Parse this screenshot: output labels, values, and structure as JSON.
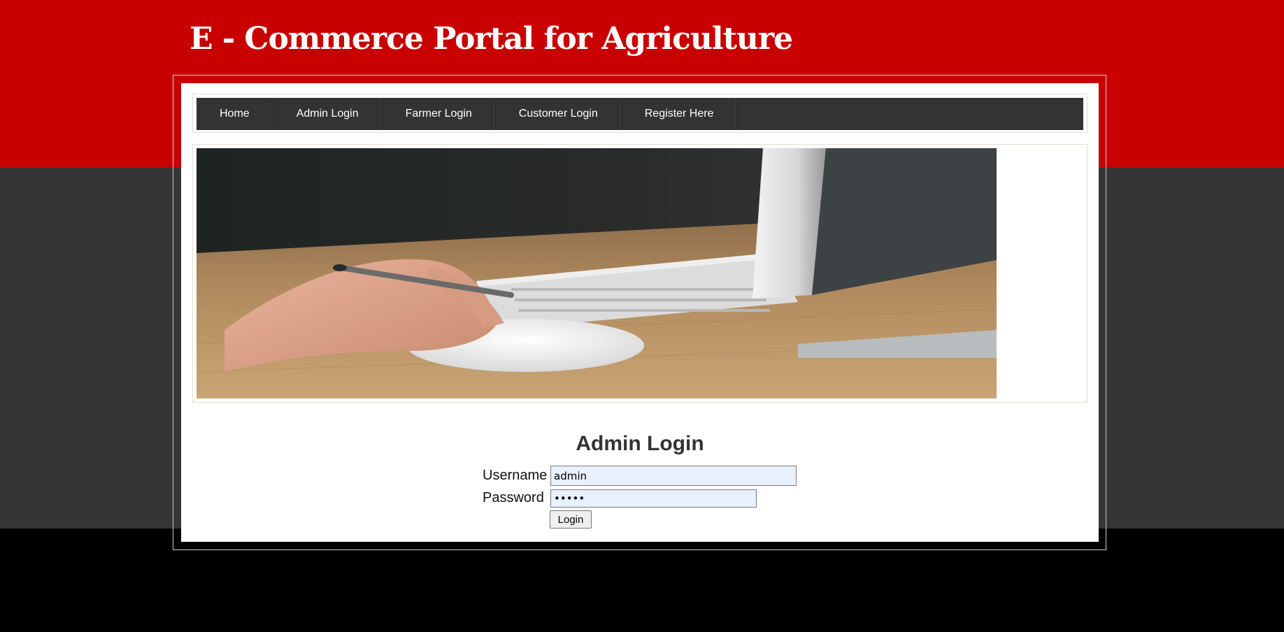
{
  "site": {
    "title": "E - Commerce Portal for Agriculture"
  },
  "nav": {
    "items": [
      {
        "label": "Home"
      },
      {
        "label": "Admin Login"
      },
      {
        "label": "Farmer Login"
      },
      {
        "label": "Customer Login"
      },
      {
        "label": "Register Here"
      }
    ]
  },
  "banner": {
    "image": "photo of a hand holding a pen resting on a white computer mouse beside a keyboard and monitor on a wooden desk"
  },
  "login": {
    "title": "Admin Login",
    "username_label": "Username",
    "username_value": "admin",
    "password_label": "Password",
    "password_value": "•••••",
    "button_label": "Login"
  },
  "colors": {
    "header_red": "#c80000",
    "body_gray": "#353535",
    "footer_black": "#000000",
    "nav_bg": "#333333"
  }
}
